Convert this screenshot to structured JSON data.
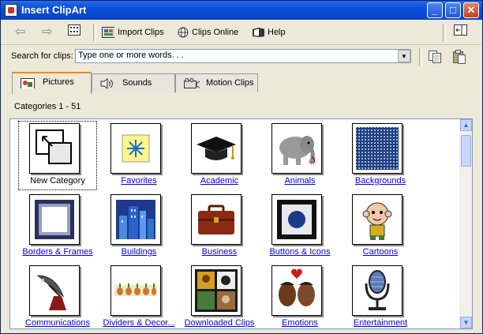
{
  "window": {
    "title": "Insert ClipArt"
  },
  "titlebar_buttons": {
    "minimize": "_",
    "maximize": "□",
    "close": "✕"
  },
  "toolbar": {
    "back_label": "⇦",
    "forward_label": "⇨",
    "import_label": "Import Clips",
    "online_label": "Clips Online",
    "help_label": "Help"
  },
  "search": {
    "label": "Search for clips:",
    "value": "Type one or more words. . ."
  },
  "tabs": [
    {
      "label": "Pictures",
      "icon": "pictures-icon",
      "active": true
    },
    {
      "label": "Sounds",
      "icon": "speaker-icon",
      "active": false
    },
    {
      "label": "Motion Clips",
      "icon": "camera-icon",
      "active": false
    }
  ],
  "categories_label": "Categories 1 - 51",
  "categories": [
    {
      "label": "New Category",
      "icon": "new-category-icon"
    },
    {
      "label": "Favorites",
      "icon": "favorites-icon"
    },
    {
      "label": "Academic",
      "icon": "graduation-cap-icon"
    },
    {
      "label": "Animals",
      "icon": "elephant-icon"
    },
    {
      "label": "Backgrounds",
      "icon": "backgrounds-icon"
    },
    {
      "label": "Borders & Frames",
      "icon": "frame-icon"
    },
    {
      "label": "Buildings",
      "icon": "buildings-icon"
    },
    {
      "label": "Business",
      "icon": "briefcase-icon"
    },
    {
      "label": "Buttons & Icons",
      "icon": "button-icon"
    },
    {
      "label": "Cartoons",
      "icon": "cartoon-icon"
    },
    {
      "label": "Communications",
      "icon": "satellite-dish-icon"
    },
    {
      "label": "Dividers & Decor...",
      "icon": "divider-icon"
    },
    {
      "label": "Downloaded Clips",
      "icon": "downloaded-icon"
    },
    {
      "label": "Emotions",
      "icon": "emotions-icon"
    },
    {
      "label": "Entertainment",
      "icon": "microphone-icon"
    }
  ]
}
